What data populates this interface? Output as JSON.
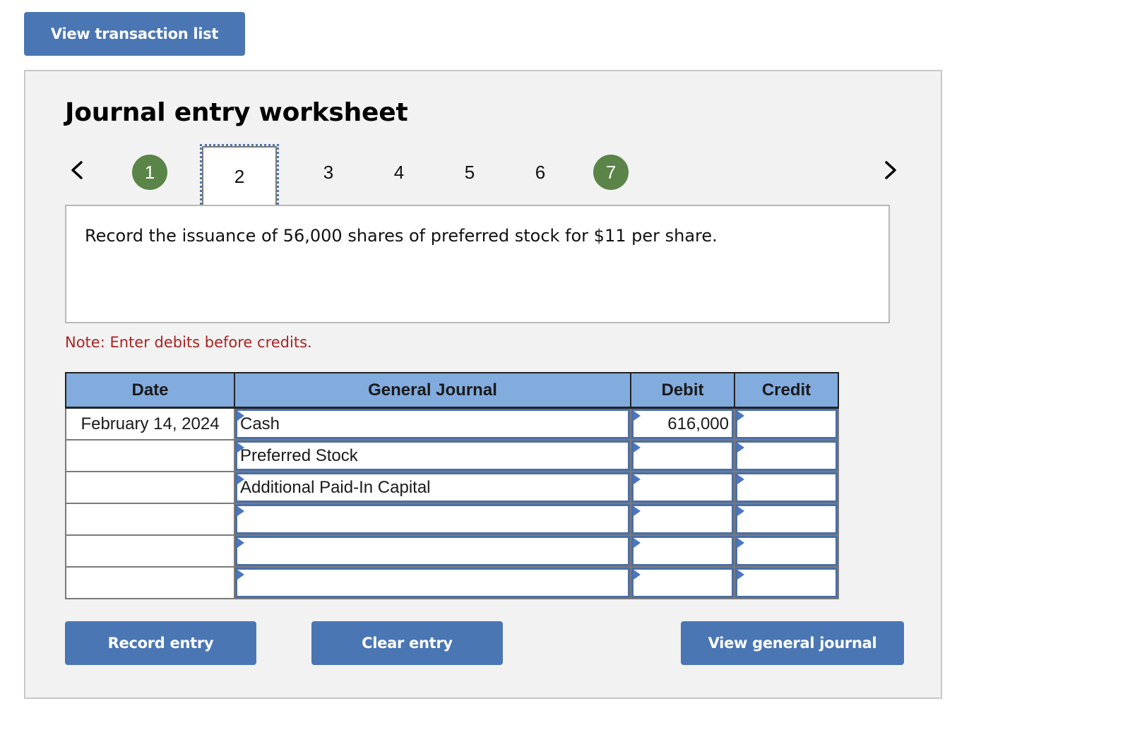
{
  "top_button": {
    "label": "View transaction list"
  },
  "worksheet": {
    "title": "Journal entry worksheet",
    "steps": [
      {
        "label": "1",
        "state": "done"
      },
      {
        "label": "2",
        "state": "current"
      },
      {
        "label": "3",
        "state": "pending"
      },
      {
        "label": "4",
        "state": "pending"
      },
      {
        "label": "5",
        "state": "pending"
      },
      {
        "label": "6",
        "state": "pending"
      },
      {
        "label": "7",
        "state": "done"
      }
    ],
    "prev_icon": "chevron-left-icon",
    "next_icon": "chevron-right-icon",
    "description": "Record the issuance of 56,000 shares of preferred stock for $11 per share.",
    "note": "Note: Enter debits before credits.",
    "table": {
      "headers": {
        "date": "Date",
        "account": "General Journal",
        "debit": "Debit",
        "credit": "Credit"
      },
      "rows": [
        {
          "date": "February 14, 2024",
          "account": "Cash",
          "debit": "616,000",
          "credit": ""
        },
        {
          "date": "",
          "account": "Preferred Stock",
          "debit": "",
          "credit": ""
        },
        {
          "date": "",
          "account": "Additional Paid-In Capital",
          "debit": "",
          "credit": ""
        },
        {
          "date": "",
          "account": "",
          "debit": "",
          "credit": ""
        },
        {
          "date": "",
          "account": "",
          "debit": "",
          "credit": ""
        },
        {
          "date": "",
          "account": "",
          "debit": "",
          "credit": ""
        }
      ]
    },
    "buttons": {
      "record": "Record entry",
      "clear": "Clear entry",
      "view_journal": "View general journal"
    }
  },
  "colors": {
    "button": "#4a76b4",
    "header": "#82abde",
    "step_done": "#5a8448",
    "note": "#a82424",
    "panel": "#f2f2f2"
  }
}
